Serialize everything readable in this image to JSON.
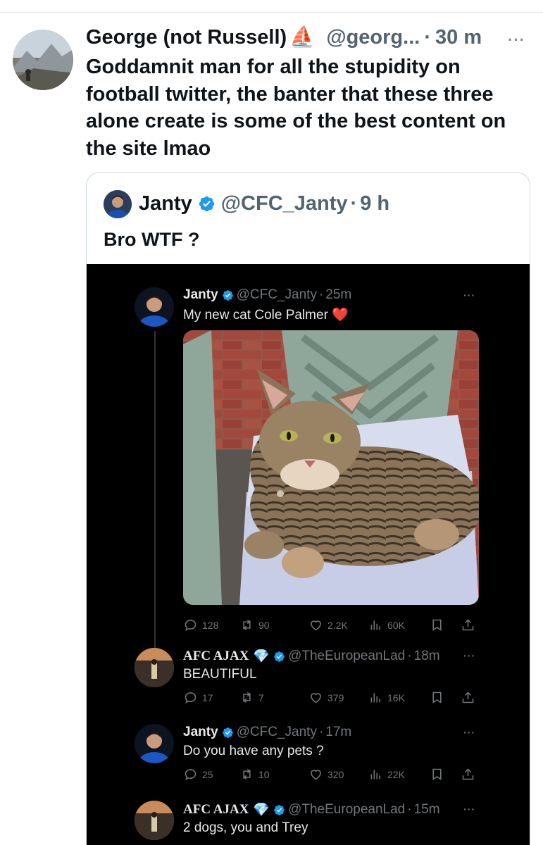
{
  "outer_tweet": {
    "author_name": "George (not Russell)",
    "boat_emoji": "⛵",
    "handle": "@georg...",
    "separator": "·",
    "time": "30 m",
    "text": "Goddamnit man for all the stupidity on football twitter, the banter that these three alone create is some of the best content on the site lmao"
  },
  "quote": {
    "author_name": "Janty",
    "handle": "@CFC_Janty",
    "separator": "·",
    "time": "9 h",
    "text": "Bro WTF ?"
  },
  "thread": [
    {
      "name": "Janty",
      "handle": "@CFC_Janty",
      "time": "25m",
      "text": "My new cat Cole Palmer",
      "heart_emoji": "❤️",
      "replies": "128",
      "reposts": "90",
      "likes": "2.2K",
      "views": "60K"
    },
    {
      "name": "AFC AJAX",
      "diamond_emoji": "💎",
      "handle": "@TheEuropeanLad",
      "time": "18m",
      "text": "BEAUTIFUL",
      "replies": "17",
      "reposts": "7",
      "likes": "379",
      "views": "16K"
    },
    {
      "name": "Janty",
      "handle": "@CFC_Janty",
      "time": "17m",
      "text": "Do you have any pets ?",
      "replies": "25",
      "reposts": "10",
      "likes": "320",
      "views": "22K"
    },
    {
      "name": "AFC AJAX",
      "diamond_emoji": "💎",
      "handle": "@TheEuropeanLad",
      "time": "15m",
      "text": "2 dogs, you and Trey"
    }
  ],
  "separator": "·",
  "more_glyph": "···",
  "colors": {
    "verified_blue": "#1d9bf0",
    "dark_bg": "#000000",
    "muted_gray": "#71767b",
    "text_light": "#e7e9ea"
  }
}
